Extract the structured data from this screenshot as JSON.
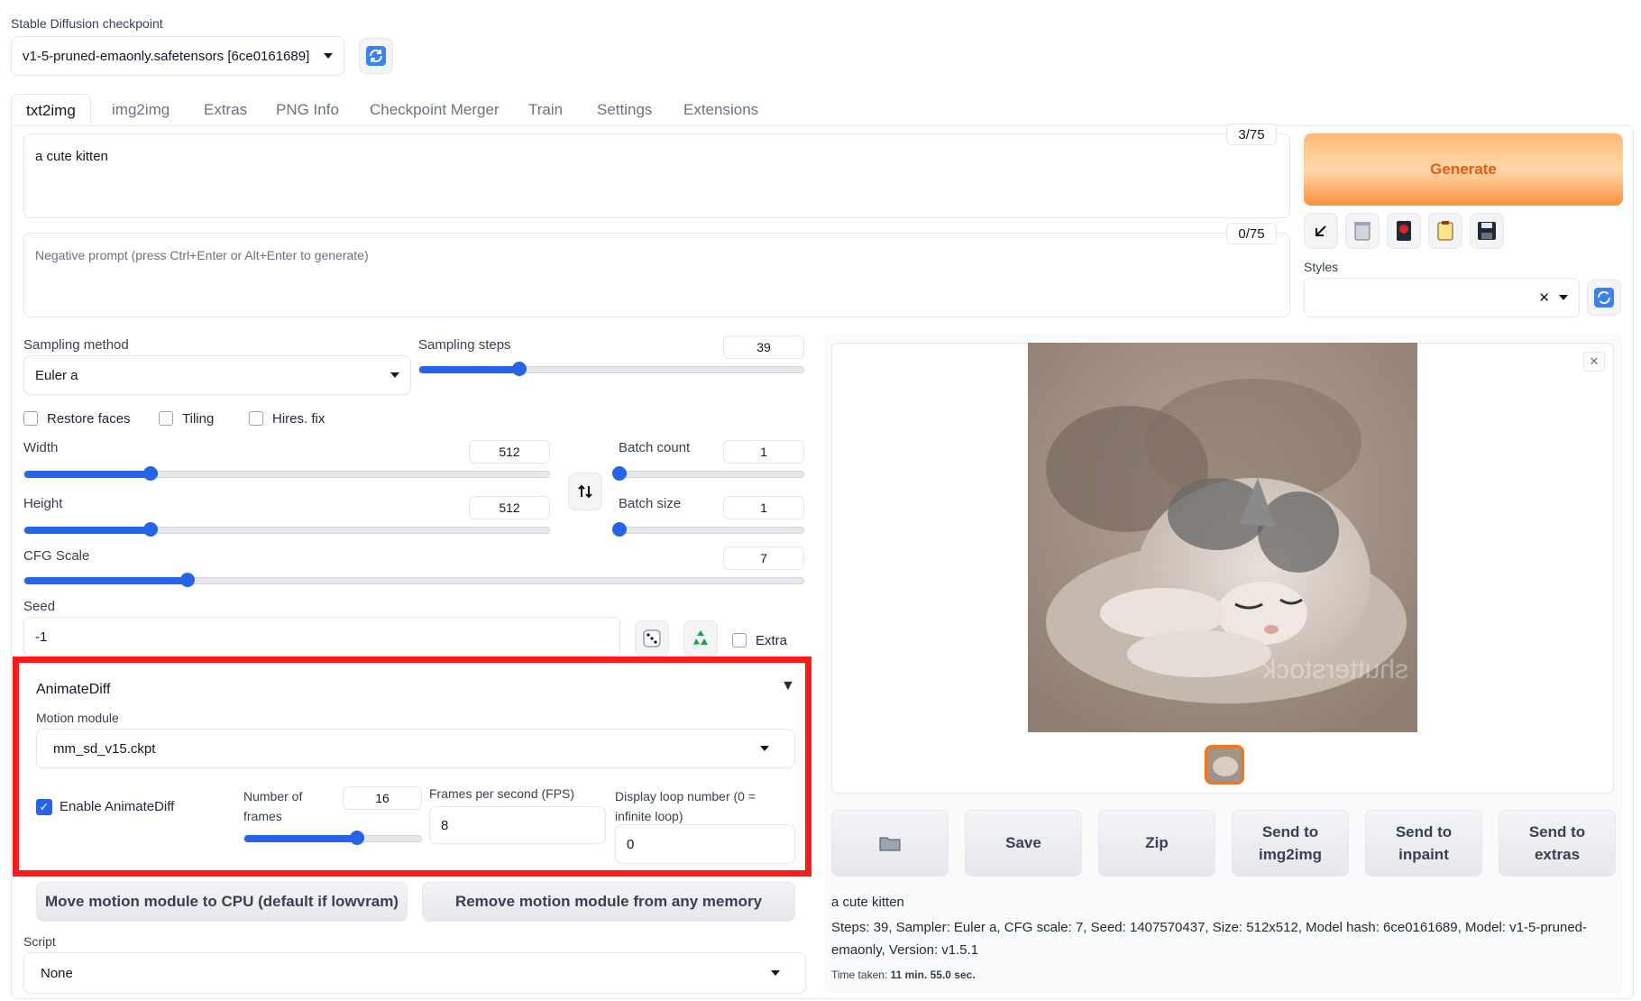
{
  "checkpoint": {
    "label": "Stable Diffusion checkpoint",
    "value": "v1-5-pruned-emaonly.safetensors [6ce0161689]"
  },
  "tabs": [
    "txt2img",
    "img2img",
    "Extras",
    "PNG Info",
    "Checkpoint Merger",
    "Train",
    "Settings",
    "Extensions"
  ],
  "prompt": {
    "value": "a cute kitten",
    "token_count": "3/75"
  },
  "negative_prompt": {
    "placeholder": "Negative prompt (press Ctrl+Enter or Alt+Enter to generate)",
    "token_count": "0/75"
  },
  "generate_label": "Generate",
  "styles_label": "Styles",
  "sampling": {
    "method_label": "Sampling method",
    "method_value": "Euler a",
    "steps_label": "Sampling steps",
    "steps_value": "39",
    "steps_fraction": 0.26
  },
  "checkboxes": {
    "restore_faces": "Restore faces",
    "tiling": "Tiling",
    "hires_fix": "Hires. fix"
  },
  "width": {
    "label": "Width",
    "value": "512",
    "fraction": 0.24
  },
  "height": {
    "label": "Height",
    "value": "512",
    "fraction": 0.24
  },
  "batch_count": {
    "label": "Batch count",
    "value": "1",
    "fraction": 0.0
  },
  "batch_size": {
    "label": "Batch size",
    "value": "1",
    "fraction": 0.0
  },
  "cfg": {
    "label": "CFG Scale",
    "value": "7",
    "fraction": 0.21
  },
  "seed": {
    "label": "Seed",
    "value": "-1",
    "extra_label": "Extra"
  },
  "animatediff": {
    "title": "AnimateDiff",
    "motion_module_label": "Motion module",
    "motion_module_value": "mm_sd_v15.ckpt",
    "enable_label": "Enable AnimateDiff",
    "frames_label": "Number of frames",
    "frames_value": "16",
    "frames_fraction": 0.64,
    "fps_label": "Frames per second (FPS)",
    "fps_value": "8",
    "loop_label": "Display loop number (0 = infinite loop)",
    "loop_value": "0",
    "move_cpu_label": "Move motion module to CPU (default if lowvram)",
    "remove_label": "Remove motion module from any memory",
    "highlight_color": "#ff1a1a"
  },
  "script": {
    "label": "Script",
    "value": "None"
  },
  "output": {
    "buttons": {
      "save": "Save",
      "zip": "Zip",
      "send_img2img": "Send to img2img",
      "send_inpaint": "Send to inpaint",
      "send_extras": "Send to extras"
    },
    "info_prompt": "a cute kitten",
    "info_params": "Steps: 39, Sampler: Euler a, CFG scale: 7, Seed: 1407570437, Size: 512x512, Model hash: 6ce0161689, Model: v1-5-pruned-emaonly, Version: v1.5.1",
    "time_label": "Time taken:",
    "time_value": "11 min. 55.0 sec.",
    "watermark": "shutterstock"
  },
  "colors": {
    "accent": "#2563eb",
    "generate_text": "#ea580c"
  }
}
